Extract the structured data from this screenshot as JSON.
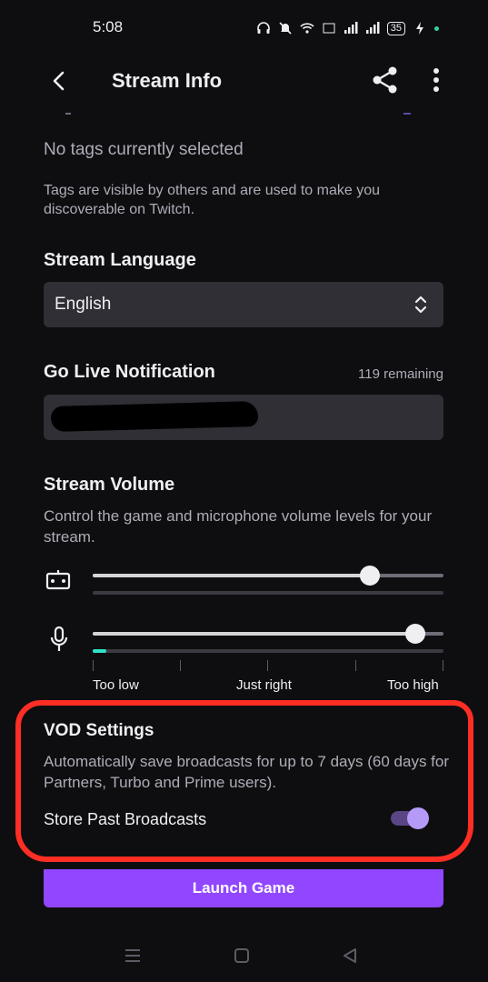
{
  "status_bar": {
    "time": "5:08",
    "battery": "35",
    "icons": [
      "headphones-icon",
      "mute-icon",
      "wifi-icon",
      "volte-icon",
      "signal-icon",
      "signal-icon",
      "battery-icon",
      "charging-icon"
    ]
  },
  "header": {
    "title": "Stream Info",
    "back_icon": "chevron-left-icon",
    "share_icon": "share-icon",
    "more_icon": "more-vertical-icon"
  },
  "tags": {
    "empty_text": "No tags currently selected",
    "help_text": "Tags are visible by others and are used to make you discoverable on Twitch."
  },
  "stream_language": {
    "title": "Stream Language",
    "selected": "English"
  },
  "go_live": {
    "title": "Go Live Notification",
    "remaining": "119 remaining"
  },
  "stream_volume": {
    "title": "Stream Volume",
    "description": "Control the game and microphone volume levels for your stream.",
    "game_volume": 0.79,
    "mic_volume": 0.92,
    "mic_level": 0.04,
    "scale": [
      "Too low",
      "Just right",
      "Too high"
    ]
  },
  "vod": {
    "title": "VOD Settings",
    "description": "Automatically save broadcasts for up to 7 days (60 days for Partners, Turbo and Prime users).",
    "store_label": "Store Past Broadcasts",
    "store_enabled": true
  },
  "launch_button": "Launch Game",
  "colors": {
    "accent": "#9147ff",
    "highlight_outline": "#ff2e24",
    "meter": "#2ee3c8"
  }
}
